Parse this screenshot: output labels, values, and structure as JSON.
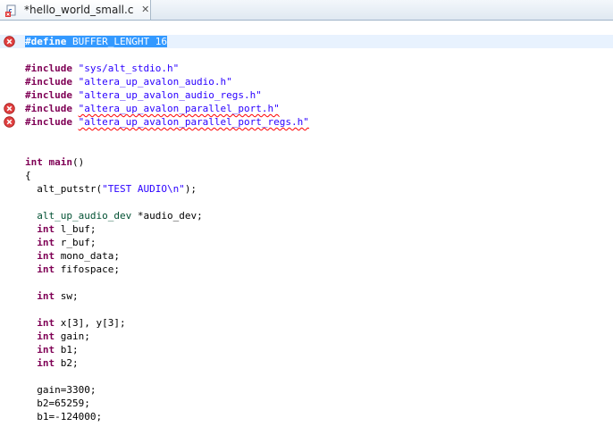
{
  "tab": {
    "title": "*hello_world_small.c",
    "close_glyph": "✕",
    "icon": "c-source-file-error-icon"
  },
  "editor": {
    "lines": [
      {
        "row": 0,
        "error": true,
        "current": true,
        "parts": [
          {
            "c": "kw sel",
            "t": "#define"
          },
          {
            "c": "sel",
            "t": " BUFFER_LENGHT 16"
          }
        ]
      },
      {
        "row": 2,
        "parts": [
          {
            "c": "kw",
            "t": "#include"
          },
          {
            "c": "",
            "t": " "
          },
          {
            "c": "str",
            "t": "\"sys/alt_stdio.h\""
          }
        ]
      },
      {
        "row": 3,
        "parts": [
          {
            "c": "kw",
            "t": "#include"
          },
          {
            "c": "",
            "t": " "
          },
          {
            "c": "str",
            "t": "\"altera_up_avalon_audio.h\""
          }
        ]
      },
      {
        "row": 4,
        "parts": [
          {
            "c": "kw",
            "t": "#include"
          },
          {
            "c": "",
            "t": " "
          },
          {
            "c": "str",
            "t": "\"altera_up_avalon_audio_regs.h\""
          }
        ]
      },
      {
        "row": 5,
        "error": true,
        "parts": [
          {
            "c": "kw",
            "t": "#include"
          },
          {
            "c": "",
            "t": " "
          },
          {
            "c": "str err",
            "t": "\"altera_up_avalon_parallel_port.h\""
          }
        ]
      },
      {
        "row": 6,
        "error": true,
        "parts": [
          {
            "c": "kw",
            "t": "#include"
          },
          {
            "c": "",
            "t": " "
          },
          {
            "c": "str err",
            "t": "\"altera_up_avalon_parallel_port_regs.h\""
          }
        ]
      },
      {
        "row": 9,
        "parts": [
          {
            "c": "kw",
            "t": "int"
          },
          {
            "c": "",
            "t": " "
          },
          {
            "c": "kw",
            "t": "main"
          },
          {
            "c": "",
            "t": "()"
          }
        ]
      },
      {
        "row": 10,
        "parts": [
          {
            "c": "",
            "t": "{"
          }
        ]
      },
      {
        "row": 11,
        "parts": [
          {
            "c": "",
            "t": "  alt_putstr("
          },
          {
            "c": "str",
            "t": "\"TEST AUDIO\\n\""
          },
          {
            "c": "",
            "t": ");"
          }
        ]
      },
      {
        "row": 13,
        "parts": [
          {
            "c": "",
            "t": "  "
          },
          {
            "c": "typ",
            "t": "alt_up_audio_dev"
          },
          {
            "c": "",
            "t": " *audio_dev;"
          }
        ]
      },
      {
        "row": 14,
        "parts": [
          {
            "c": "",
            "t": "  "
          },
          {
            "c": "kw",
            "t": "int"
          },
          {
            "c": "",
            "t": " l_buf;"
          }
        ]
      },
      {
        "row": 15,
        "parts": [
          {
            "c": "",
            "t": "  "
          },
          {
            "c": "kw",
            "t": "int"
          },
          {
            "c": "",
            "t": " r_buf;"
          }
        ]
      },
      {
        "row": 16,
        "parts": [
          {
            "c": "",
            "t": "  "
          },
          {
            "c": "kw",
            "t": "int"
          },
          {
            "c": "",
            "t": " mono_data;"
          }
        ]
      },
      {
        "row": 17,
        "parts": [
          {
            "c": "",
            "t": "  "
          },
          {
            "c": "kw",
            "t": "int"
          },
          {
            "c": "",
            "t": " fifospace;"
          }
        ]
      },
      {
        "row": 19,
        "parts": [
          {
            "c": "",
            "t": "  "
          },
          {
            "c": "kw",
            "t": "int"
          },
          {
            "c": "",
            "t": " sw;"
          }
        ]
      },
      {
        "row": 21,
        "parts": [
          {
            "c": "",
            "t": "  "
          },
          {
            "c": "kw",
            "t": "int"
          },
          {
            "c": "",
            "t": " x[3], y[3];"
          }
        ]
      },
      {
        "row": 22,
        "parts": [
          {
            "c": "",
            "t": "  "
          },
          {
            "c": "kw",
            "t": "int"
          },
          {
            "c": "",
            "t": " gain;"
          }
        ]
      },
      {
        "row": 23,
        "parts": [
          {
            "c": "",
            "t": "  "
          },
          {
            "c": "kw",
            "t": "int"
          },
          {
            "c": "",
            "t": " b1;"
          }
        ]
      },
      {
        "row": 24,
        "parts": [
          {
            "c": "",
            "t": "  "
          },
          {
            "c": "kw",
            "t": "int"
          },
          {
            "c": "",
            "t": " b2;"
          }
        ]
      },
      {
        "row": 26,
        "parts": [
          {
            "c": "",
            "t": "  gain=3300;"
          }
        ]
      },
      {
        "row": 27,
        "parts": [
          {
            "c": "",
            "t": "  b2=65259;"
          }
        ]
      },
      {
        "row": 28,
        "parts": [
          {
            "c": "",
            "t": "  b1=-124000;"
          }
        ]
      }
    ]
  },
  "colors": {
    "keyword": "#7f0055",
    "string": "#2a00ff",
    "type": "#005032",
    "selection": "#3399ff",
    "error_marker": "#e04040"
  }
}
